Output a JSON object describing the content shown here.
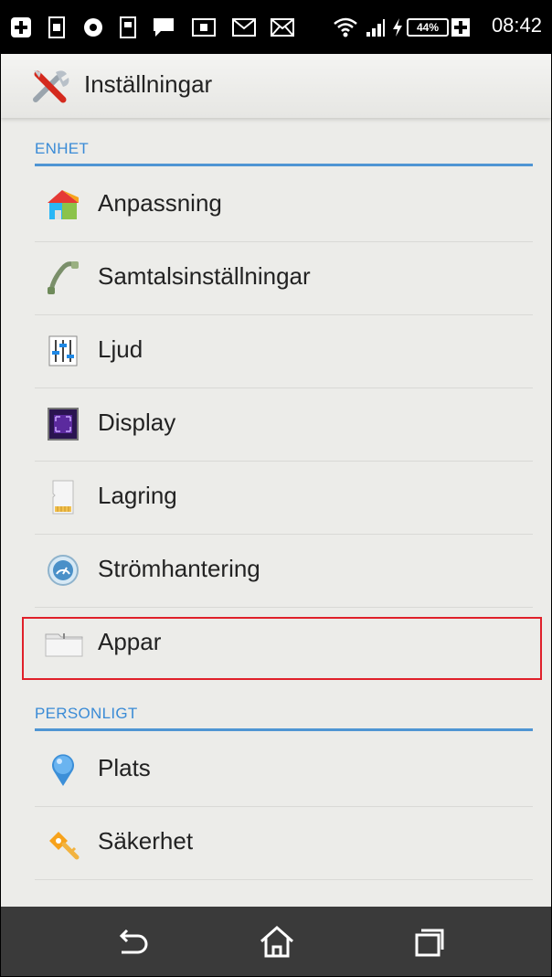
{
  "statusbar": {
    "battery": "44%",
    "time": "08:42",
    "left_icons": [
      "plus-badge-icon",
      "sim-icon",
      "circle-icon",
      "sd-icon",
      "chat-icon",
      "card-icon",
      "gmail-icon",
      "mail-icon"
    ],
    "right_icons": [
      "wifi-icon",
      "signal-icon",
      "charging-icon",
      "battery-icon"
    ]
  },
  "actionbar": {
    "title": "Inställningar",
    "icon": "settings-tools-icon"
  },
  "sections": [
    {
      "id": "enhet",
      "label": "ENHET"
    },
    {
      "id": "personligt",
      "label": "PERSONLIGT"
    }
  ],
  "items": [
    {
      "label": "Anpassning",
      "icon": "personalize-icon"
    },
    {
      "label": "Samtalsinställningar",
      "icon": "phone-handset-icon"
    },
    {
      "label": "Ljud",
      "icon": "equalizer-icon"
    },
    {
      "label": "Display",
      "icon": "display-icon"
    },
    {
      "label": "Lagring",
      "icon": "sd-card-icon"
    },
    {
      "label": "Strömhantering",
      "icon": "power-gauge-icon"
    },
    {
      "label": "Appar",
      "icon": "folder-icon"
    },
    {
      "label": "Plats",
      "icon": "location-pin-icon"
    },
    {
      "label": "Säkerhet",
      "icon": "key-icon"
    }
  ],
  "colors": {
    "accent": "#4f95d3",
    "highlight": "#e0202a",
    "background": "#ecece9",
    "navbar": "#3a3a3a"
  },
  "navbar": [
    "back-icon",
    "home-icon",
    "recent-apps-icon"
  ]
}
